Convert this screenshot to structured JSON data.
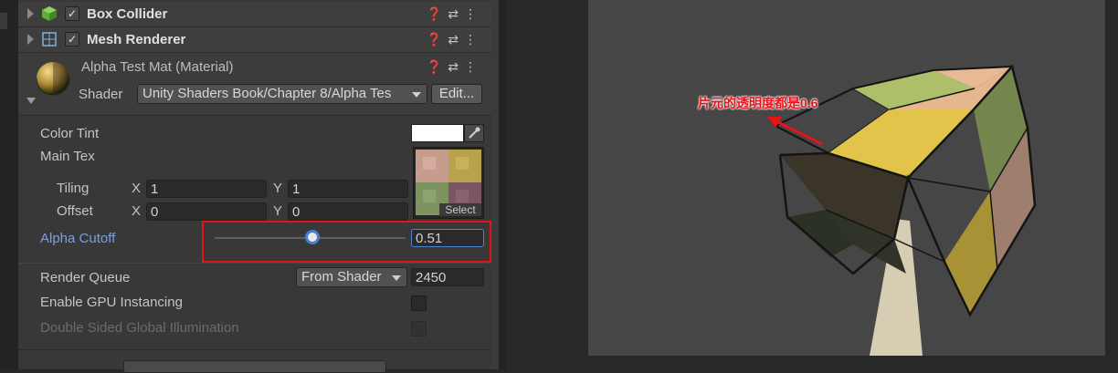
{
  "components": [
    {
      "name": "Box Collider",
      "enabled": true
    },
    {
      "name": "Mesh Renderer",
      "enabled": true
    }
  ],
  "material": {
    "title": "Alpha Test Mat (Material)",
    "shader_label": "Shader",
    "shader_value": "Unity Shaders Book/Chapter 8/Alpha Tes",
    "edit_label": "Edit..."
  },
  "properties": {
    "color_tint_label": "Color Tint",
    "color_tint_value": "#FFFFFF",
    "main_tex_label": "Main Tex",
    "tiling_label": "Tiling",
    "offset_label": "Offset",
    "x_label": "X",
    "y_label": "Y",
    "tiling_x": "1",
    "tiling_y": "1",
    "offset_x": "0",
    "offset_y": "0",
    "select_label": "Select",
    "alpha_cutoff_label": "Alpha Cutoff",
    "alpha_cutoff_value": "0.51",
    "alpha_cutoff_fraction": 0.51
  },
  "advanced": {
    "render_queue_label": "Render Queue",
    "render_queue_mode": "From Shader",
    "render_queue_value": "2450",
    "gpu_instancing_label": "Enable GPU Instancing",
    "gpu_instancing_checked": false,
    "double_sided_gi_label": "Double Sided Global Illumination",
    "double_sided_gi_checked": false
  },
  "annotation": {
    "text": "片元的透明度都是0.6",
    "color": "#e8121b"
  },
  "icons": [
    "box-collider-icon",
    "mesh-renderer-icon",
    "help-icon",
    "preset-icon",
    "kebab-menu-icon",
    "eyedropper-icon",
    "material-sphere-icon"
  ],
  "colors": {
    "highlight_box": "#e2151b",
    "slider_knob": "#4a7fcf",
    "alpha_label": "#7aa1dc"
  }
}
